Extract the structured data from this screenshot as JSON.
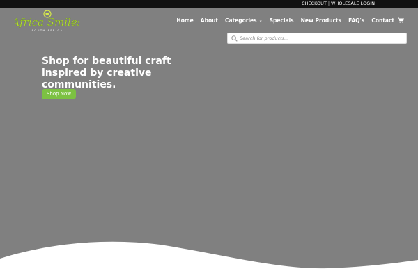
{
  "topbar": {
    "links": [
      "CHECKOUT",
      "WHOLESALE LOGIN"
    ],
    "separator": "|"
  },
  "logo": {
    "text": "Africa Smiles",
    "subtext": "SOUTH AFRICA",
    "color": "#7cc142"
  },
  "nav": {
    "items": [
      {
        "label": "Home"
      },
      {
        "label": "About"
      },
      {
        "label": "Categories"
      },
      {
        "label": "Specials"
      },
      {
        "label": "New Products"
      },
      {
        "label": "FAQ's"
      },
      {
        "label": "Contact"
      }
    ],
    "cart_icon": "cart-icon"
  },
  "search": {
    "placeholder": "Search for products..."
  },
  "hero": {
    "title": "Shop for beautiful craft inspired by creative communities.",
    "button_label": "Shop Now",
    "background_color": "#808080",
    "button_color": "#7cc142"
  }
}
